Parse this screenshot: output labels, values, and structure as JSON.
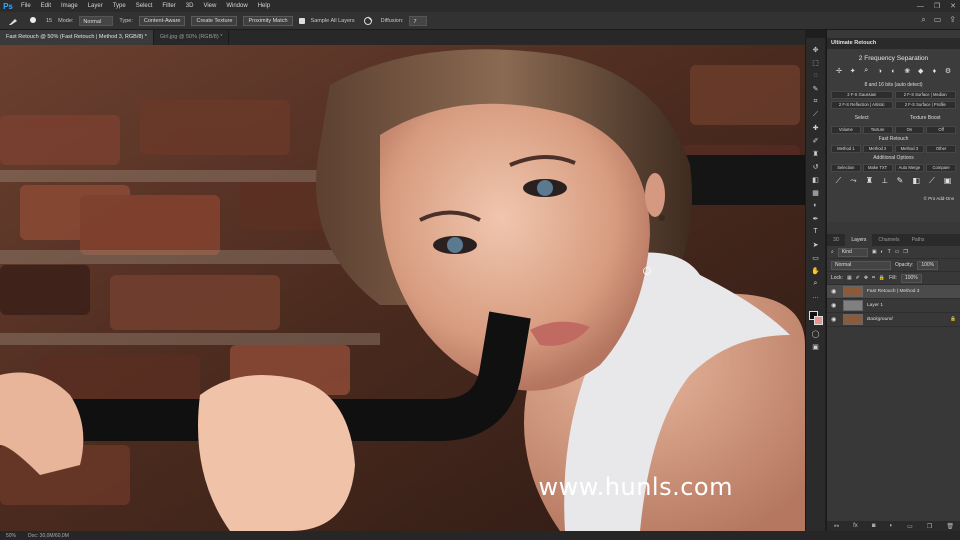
{
  "app": {
    "logo": "Ps"
  },
  "menu": [
    "File",
    "Edit",
    "Image",
    "Layer",
    "Type",
    "Select",
    "Filter",
    "3D",
    "View",
    "Window",
    "Help"
  ],
  "window_controls": [
    "—",
    "❐",
    "✕"
  ],
  "options_bar": {
    "brush_size": "15",
    "mode_label": "Mode:",
    "mode_value": "Normal",
    "type_label": "Type:",
    "buttons": [
      "Content-Aware",
      "Create Texture",
      "Proximity Match"
    ],
    "sample_all_layers": "Sample All Layers",
    "diffusion_label": "Diffusion:",
    "diffusion_value": "7"
  },
  "tabs": [
    {
      "label": "Fast Retouch @ 50% (Fast Retouch | Method 3, RGB/8) *",
      "active": true
    },
    {
      "label": "Girl.jpg @ 50% (RGB/8) *",
      "active": false
    }
  ],
  "watermark": "www.hunls.com",
  "status": {
    "zoom": "50%",
    "doc": "Doc: 30,0M/60,0M"
  },
  "ultimate_retouch": {
    "header": "Ultimate Retouch",
    "title": "2 Frequency Separation",
    "bits": "8 and 16 bits (auto detect)",
    "rows1": [
      [
        "2 F-S Gaussian",
        "2 F-S Surface | Median"
      ],
      [
        "2 F-S Reflection | Artistic",
        "2 F-S Surface | Profile"
      ]
    ],
    "select_label": "Select",
    "texture_label": "Texture Boost",
    "select_row": [
      "Volume",
      "Texture",
      "On",
      "Off"
    ],
    "fast_label": "Fast Retouch",
    "fast_row": [
      "Method 1",
      "Method 2",
      "Method 3",
      "Other"
    ],
    "additional_label": "Additional Options",
    "additional_row": [
      "Selection",
      "Make TXT",
      "Auto Merge",
      "Compare"
    ],
    "footer": "© Pro Add-Ons"
  },
  "layers_panel": {
    "tabs": [
      "3D",
      "Layers",
      "Channels",
      "Paths"
    ],
    "kind": "Kind",
    "blend": "Normal",
    "opacity_label": "Opacity:",
    "opacity_value": "100%",
    "lock_label": "Lock:",
    "fill_label": "Fill:",
    "fill_value": "100%",
    "layers": [
      {
        "name": "Fast Retouch | Method 3",
        "thumb": "photo",
        "selected": true
      },
      {
        "name": "Layer 1",
        "thumb": "grey",
        "selected": false
      },
      {
        "name": "Background",
        "thumb": "photo",
        "selected": false
      }
    ]
  }
}
